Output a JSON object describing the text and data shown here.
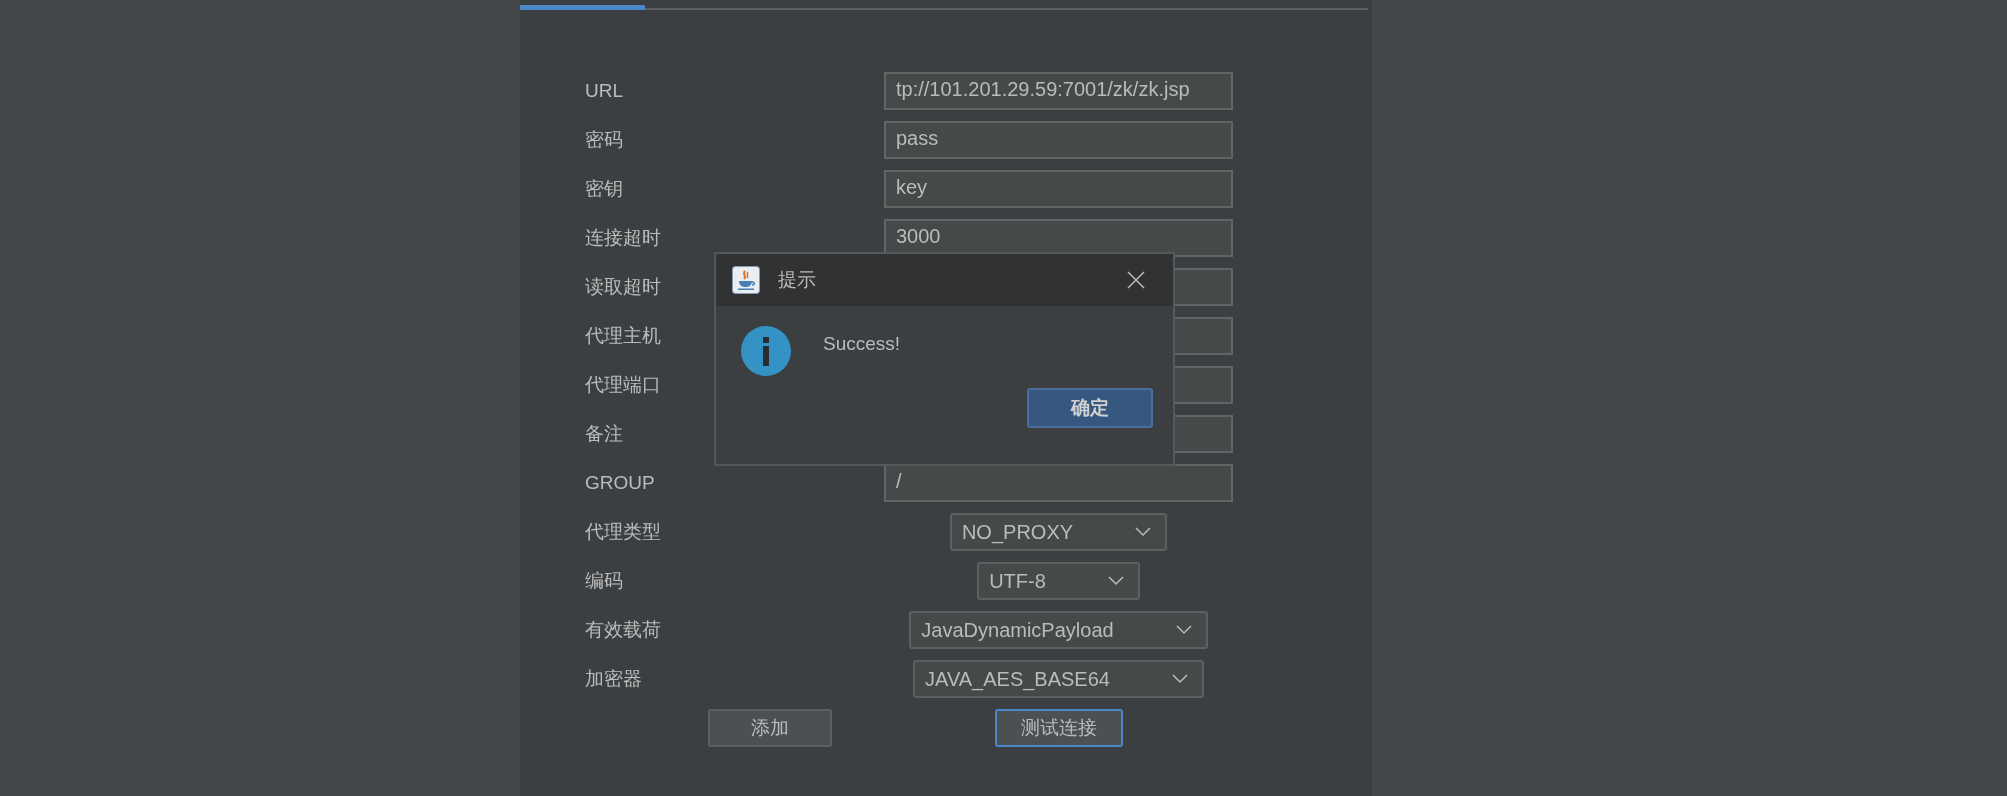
{
  "form": {
    "fields": [
      {
        "label": "URL",
        "kind": "text",
        "value": "tp://101.201.29.59:7001/zk/zk.jsp"
      },
      {
        "label": "密码",
        "kind": "text",
        "value": "pass"
      },
      {
        "label": "密钥",
        "kind": "text",
        "value": "key"
      },
      {
        "label": "连接超时",
        "kind": "text",
        "value": "3000"
      },
      {
        "label": "读取超时",
        "kind": "text"
      },
      {
        "label": "代理主机",
        "kind": "text"
      },
      {
        "label": "代理端口",
        "kind": "text"
      },
      {
        "label": "备注",
        "kind": "text"
      },
      {
        "label": "GROUP",
        "kind": "text",
        "value": "/"
      },
      {
        "label": "代理类型",
        "kind": "dropdown",
        "value": "NO_PROXY"
      },
      {
        "label": "编码",
        "kind": "dropdown",
        "value": "UTF-8"
      },
      {
        "label": "有效载荷",
        "kind": "dropdown",
        "value": "JavaDynamicPayload"
      },
      {
        "label": "加密器",
        "kind": "dropdown",
        "value": "JAVA_AES_BASE64"
      }
    ]
  },
  "buttons": [
    {
      "label": "添加",
      "focused": false
    },
    {
      "label": "测试连接",
      "focused": true
    }
  ],
  "dialog": {
    "title": "提示",
    "message": "Success!",
    "button": "确定"
  }
}
